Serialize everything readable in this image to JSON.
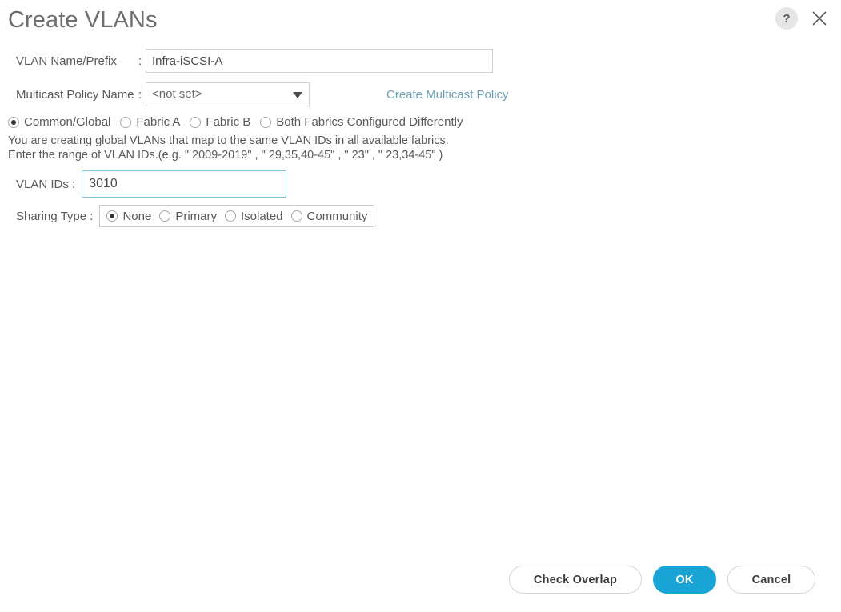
{
  "dialog": {
    "title": "Create VLANs",
    "help_icon": "question-mark-icon",
    "close_icon": "close-icon"
  },
  "form": {
    "vlan_name": {
      "label": "VLAN Name/Prefix",
      "colon": ":",
      "value": "Infra-iSCSI-A",
      "placeholder": ""
    },
    "multicast_policy": {
      "label": "Multicast Policy Name",
      "colon": ":",
      "value": "<not set>",
      "link_label": "Create Multicast Policy"
    },
    "scope": {
      "options": [
        {
          "label": "Common/Global",
          "selected": true
        },
        {
          "label": "Fabric A",
          "selected": false
        },
        {
          "label": "Fabric B",
          "selected": false
        },
        {
          "label": "Both Fabrics Configured Differently",
          "selected": false
        }
      ]
    },
    "description": {
      "line1": "You are creating global VLANs that map to the same VLAN IDs in all available fabrics.",
      "line2": "Enter the range of VLAN IDs.(e.g. \" 2009-2019\" , \" 29,35,40-45\" , \" 23\" , \" 23,34-45\" )"
    },
    "vlan_ids": {
      "label": "VLAN IDs :",
      "value": "3010",
      "placeholder": ""
    },
    "sharing_type": {
      "label": "Sharing Type  :",
      "options": [
        {
          "label": "None",
          "selected": true
        },
        {
          "label": "Primary",
          "selected": false
        },
        {
          "label": "Isolated",
          "selected": false
        },
        {
          "label": "Community",
          "selected": false
        }
      ]
    }
  },
  "footer": {
    "check_overlap_label": "Check Overlap",
    "ok_label": "OK",
    "cancel_label": "Cancel"
  },
  "colors": {
    "primary_button": "#18a5d6",
    "link": "#6b9fb3",
    "focus_border": "#77c3de",
    "title_text": "#6e6e6e",
    "body_text": "#58595b"
  }
}
